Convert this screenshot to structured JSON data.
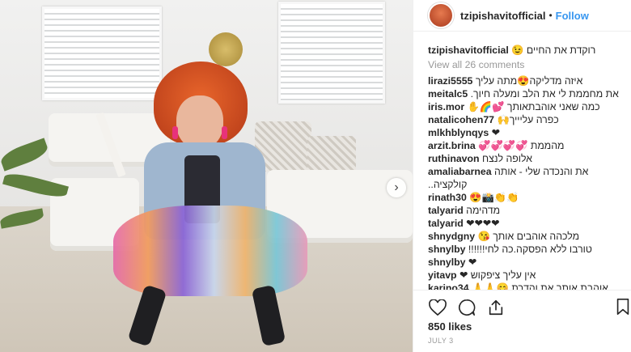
{
  "header": {
    "username": "tzipishavitofficial",
    "separator": "•",
    "follow_label": "Follow"
  },
  "caption": {
    "username": "tzipishavitofficial",
    "text": "רוקדת את החיים 😉"
  },
  "view_all": "View all 26 comments",
  "comments": [
    {
      "user": "lirazi5555",
      "text": "איזה מדליקה😍מתה עליך"
    },
    {
      "user": "meitalc5",
      "text": "את מחממת לי את הלב ומעלה חיוך."
    },
    {
      "user": "iris.mor",
      "text": "כמה שאני אוהבת‏אותך 💕🌈✋"
    },
    {
      "user": "natalicohen77",
      "text": "כפרה עליייך🙌"
    },
    {
      "user": "mlkhblynqys",
      "text": "❤"
    },
    {
      "user": "arzit.brina",
      "text": "מהממת 💞💞💞💞"
    },
    {
      "user": "ruthinavon",
      "text": "אלופה לנצח"
    },
    {
      "user": "amaliabarnea",
      "text": "את והנכדה שלי - אותה קולקציה.."
    },
    {
      "user": "rinath30",
      "text": "👏👏📸😍"
    },
    {
      "user": "talyarid",
      "text": "מדהימה"
    },
    {
      "user": "talyarid",
      "text": "❤❤❤❤"
    },
    {
      "user": "shnydgny",
      "text": "מלכהה אוהבים אותך 😘"
    },
    {
      "user": "shnylby",
      "text": "טורבו ללא הפסקה.כה לחי!!!!!!"
    },
    {
      "user": "shnylby",
      "text": "❤"
    },
    {
      "user": "yitavp",
      "text": "אין עליך ציפקוש ❤"
    },
    {
      "user": "karino34",
      "text": "אוהבת אותך את והדרת 😊🙏🙏"
    }
  ],
  "actions": {
    "like_icon": "heart-outline-icon",
    "comment_icon": "comment-bubble-icon",
    "share_icon": "share-icon",
    "save_icon": "bookmark-icon"
  },
  "likes": "850 likes",
  "date": "JULY 3",
  "carousel": {
    "next_label": "›"
  },
  "colors": {
    "accent": "#3897f0",
    "text": "#262626",
    "muted": "#999999",
    "heart": "#ed4956"
  }
}
